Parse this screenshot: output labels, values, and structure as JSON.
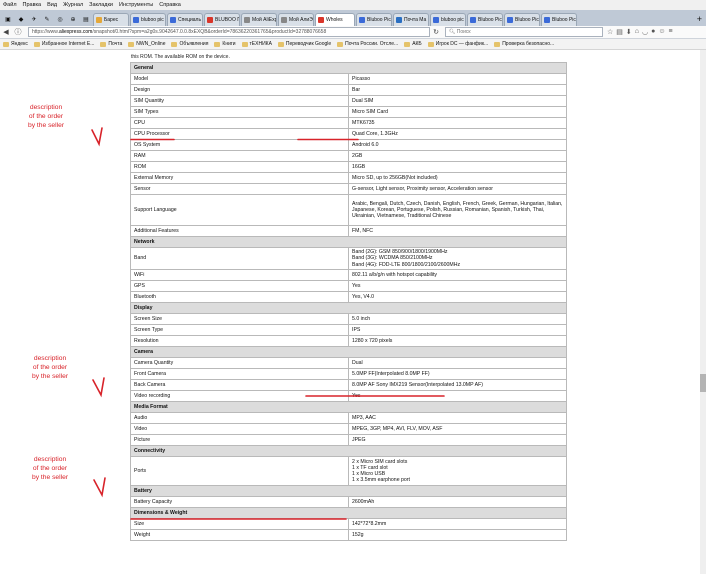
{
  "menubar": {
    "items": [
      "Файл",
      "Правка",
      "Вид",
      "Журнал",
      "Закладки",
      "Инструменты",
      "Справка"
    ]
  },
  "tabs": [
    {
      "label": "Барес",
      "color": "#e5a83a"
    },
    {
      "label": "bluboo pic",
      "color": "#3b6ad8"
    },
    {
      "label": "Специаль",
      "color": "#3b6ad8"
    },
    {
      "label": "BLUBOO П",
      "color": "#d9352a"
    },
    {
      "label": "Мой AliExpr",
      "color": "#888"
    },
    {
      "label": "Мой АлиЭкс",
      "color": "#888"
    },
    {
      "label": "Wholes",
      "color": "#d9352a",
      "active": true
    },
    {
      "label": "Bluboo Pic",
      "color": "#3b6ad8"
    },
    {
      "label": "Почта Ma",
      "color": "#2a6fc2"
    },
    {
      "label": "bluboo pic",
      "color": "#3b6ad8"
    },
    {
      "label": "Bluboo Pic",
      "color": "#3b6ad8"
    },
    {
      "label": "Bluboo Pic",
      "color": "#3b6ad8"
    },
    {
      "label": "Bluboo Pic",
      "color": "#3b6ad8"
    }
  ],
  "navbar": {
    "url_prefix": "https://www.",
    "url_domain": "aliexpress.com",
    "url_rest": "/snapshot/0.html?spm=a2g0s.9042647.0.0.8xEXQB&orderId=78636220361765&productId=32788076658",
    "search_placeholder": "Поиск"
  },
  "bookmarks": [
    "Яндекс",
    "Избранное Internet E...",
    "Почта",
    "NWN_Online",
    "Объявления",
    "Книги",
    "тЕХНИКА",
    "Переводчик Google",
    "Почта России. Отсле...",
    "АКБ",
    "Игрок DC — фанфик...",
    "Проверка безопасно..."
  ],
  "intro": "this ROM. The available ROM on the device.",
  "spec_rows": [
    {
      "type": "section",
      "k": "General"
    },
    {
      "k": "Model",
      "v": "Picasso"
    },
    {
      "k": "Design",
      "v": "Bar"
    },
    {
      "k": "SIM Quantity",
      "v": "Dual SIM"
    },
    {
      "k": "SIM Types",
      "v": "Micro SIM Card"
    },
    {
      "k": "CPU",
      "v": "MTK6735"
    },
    {
      "k": "CPU Processor",
      "v": "Quad Core, 1.3GHz"
    },
    {
      "k": "OS System",
      "v": "Android 6.0"
    },
    {
      "k": "RAM",
      "v": "2GB"
    },
    {
      "k": "ROM",
      "v": "16GB"
    },
    {
      "k": "External Memory",
      "v": "Micro SD, up to 256GB(Not included)"
    },
    {
      "k": "Sensor",
      "v": "G-sensor, Light sensor, Proximity sensor, Acceleration sensor"
    },
    {
      "k": "Support Language",
      "v": "Arabic, Bengali, Dutch, Czech, Danish, English, French, Greek, German, Hungarian, Italian, Japanese, Korean, Portuguese, Polish, Russian, Romanian, Spanish, Turkish, Thai, Ukrainian, Vietnamese, Traditional Chinese",
      "tall": "tall3"
    },
    {
      "k": "Additional Features",
      "v": "FM, NFC"
    },
    {
      "type": "section",
      "k": "Network"
    },
    {
      "k": "Band",
      "v": "Band (2G): GSM 850/900/1800/1900MHz\nBand (3G): WCDMA 850/2100MHz\nBand (4G): FDD-LTE 800/1800/2100/2600MHz",
      "tall": "tall3b"
    },
    {
      "k": "WiFi",
      "v": "802.11 a/b/g/n with hotspot capability"
    },
    {
      "k": "GPS",
      "v": "Yes"
    },
    {
      "k": "Bluetooth",
      "v": "Yes, V4.0"
    },
    {
      "type": "section",
      "k": "Display"
    },
    {
      "k": "Screen Size",
      "v": "5.0 inch"
    },
    {
      "k": "Screen Type",
      "v": "IPS"
    },
    {
      "k": "Resolution",
      "v": "1280 x 720 pixels"
    },
    {
      "type": "section",
      "k": "Camera"
    },
    {
      "k": "Camera Quantity",
      "v": "Dual"
    },
    {
      "k": "Front Camera",
      "v": "5.0MP FF(Interpolated 8.0MP FF)"
    },
    {
      "k": "Back Camera",
      "v": "8.0MP AF Sony IMX219 Sensor(Interpolated 13.0MP AF)"
    },
    {
      "k": "Video recording",
      "v": "Yes"
    },
    {
      "type": "section",
      "k": "Media Format"
    },
    {
      "k": "Audio",
      "v": "MP3, AAC"
    },
    {
      "k": "Video",
      "v": "MPEG, 3GP, MP4, AVI, FLV, MOV, ASF"
    },
    {
      "k": "Picture",
      "v": "JPEG"
    },
    {
      "type": "section",
      "k": "Connectivity"
    },
    {
      "k": "Ports",
      "v": "2 x Micro SIM card slots\n1 x TF card slot\n1 x Micro USB\n1 x 3.5mm earphone port",
      "tall": "tall4"
    },
    {
      "type": "section",
      "k": "Battery"
    },
    {
      "k": "Battery Capacity",
      "v": "2600mAh"
    },
    {
      "type": "section",
      "k": "Dimensions & Weight"
    },
    {
      "k": "Size",
      "v": "142*72*8.2mm"
    },
    {
      "k": "Weight",
      "v": "152g"
    }
  ],
  "annotations": {
    "color": "#d8232a",
    "note_lines": [
      "description",
      "of the order",
      "by the seller"
    ]
  }
}
